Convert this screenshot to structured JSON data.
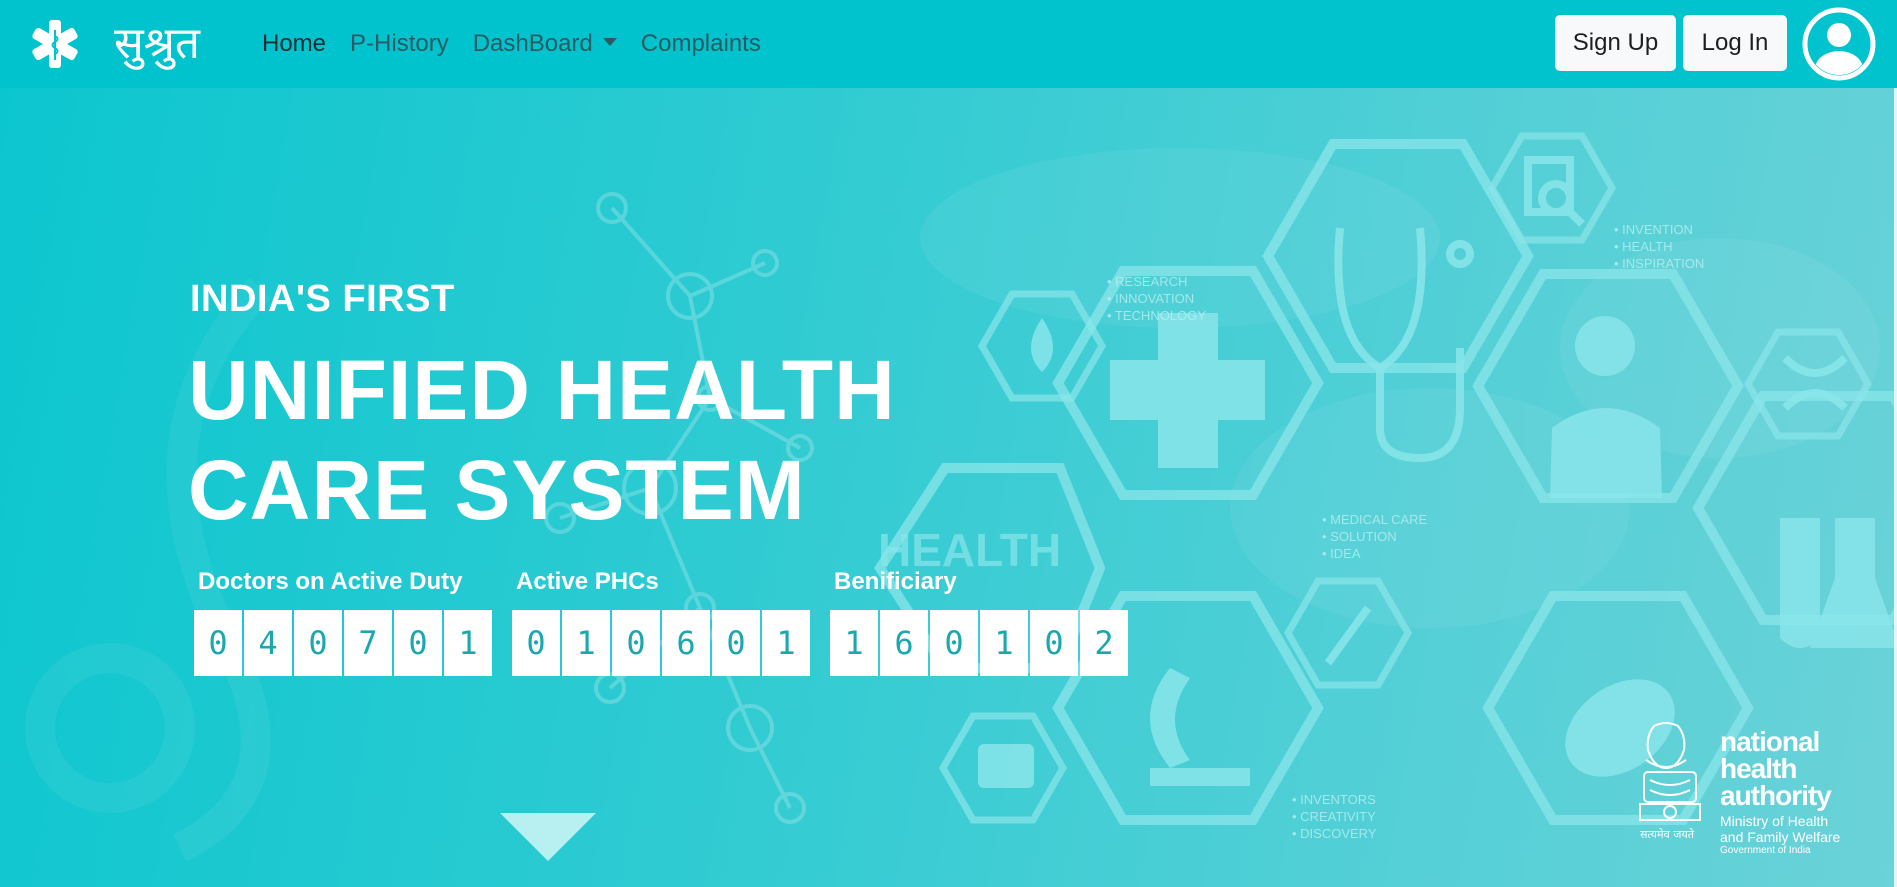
{
  "brand": {
    "name": "सुश्रुत",
    "logo_icon": "star-of-life-icon"
  },
  "nav": {
    "items": [
      {
        "label": "Home",
        "active": true
      },
      {
        "label": "P-History",
        "active": false
      },
      {
        "label": "DashBoard",
        "active": false,
        "dropdown": true
      },
      {
        "label": "Complaints",
        "active": false
      }
    ],
    "signup_label": "Sign Up",
    "login_label": "Log In",
    "avatar_icon": "user-avatar-icon"
  },
  "hero": {
    "kicker": "INDIA'S FIRST",
    "headline_line1": "UNIFIED HEALTH",
    "headline_line2": "CARE SYSTEM",
    "counters": [
      {
        "label": "Doctors on Active Duty",
        "digits": [
          "0",
          "4",
          "0",
          "7",
          "0",
          "1"
        ]
      },
      {
        "label": "Active PHCs",
        "digits": [
          "0",
          "1",
          "0",
          "6",
          "0",
          "1"
        ]
      },
      {
        "label": "Benificiary",
        "digits": [
          "1",
          "6",
          "0",
          "1",
          "0",
          "2"
        ]
      }
    ],
    "scroll_icon": "down-triangle-icon"
  },
  "background_text": {
    "group1": [
      "• RESEARCH",
      "• INNOVATION",
      "• TECHNOLOGY"
    ],
    "group2": [
      "• INVENTION",
      "• HEALTH",
      "• INSPIRATION"
    ],
    "group3": [
      "• MEDICAL CARE",
      "• SOLUTION",
      "• IDEA"
    ],
    "group4": [
      "• INVENTORS",
      "• CREATIVITY",
      "• DISCOVERY"
    ],
    "hex_word": "HEALTH"
  },
  "nha_logo": {
    "title_line1": "national",
    "title_line2": "health",
    "title_line3": "authority",
    "sub_line1": "Ministry of Health",
    "sub_line2": "and Family Welfare",
    "gov": "Government of India",
    "emblem_caption": "सत्यमेव जयते"
  },
  "colors": {
    "nav_bg": "#00c3cd",
    "hero_bg": "#2fcbd2",
    "digit_text": "#1aa8ae"
  }
}
